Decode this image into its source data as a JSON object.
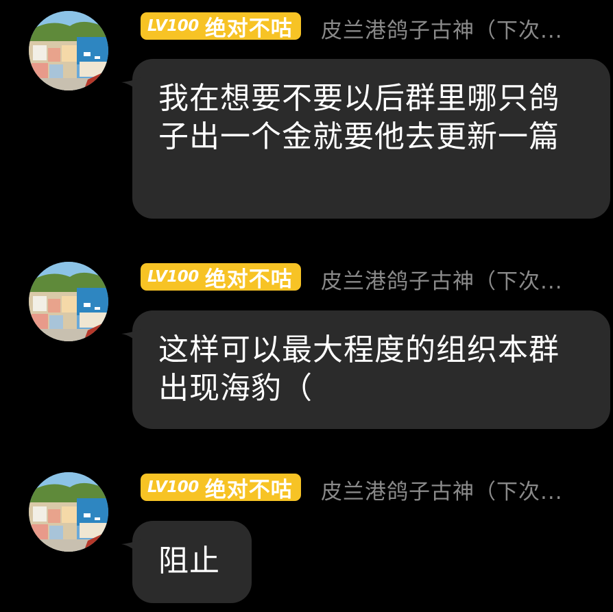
{
  "messages": [
    {
      "level": "LV100",
      "title": "绝对不咕",
      "sender": "皮兰港鸽子古神（下次...",
      "text": "我在想要不要以后群里哪只鸽子出一个金就要他去更新一篇",
      "avatar_icon": "coastal-town-avatar"
    },
    {
      "level": "LV100",
      "title": "绝对不咕",
      "sender": "皮兰港鸽子古神（下次...",
      "text": "这样可以最大程度的组织本群出现海豹（",
      "avatar_icon": "coastal-town-avatar"
    },
    {
      "level": "LV100",
      "title": "绝对不咕",
      "sender": "皮兰港鸽子古神（下次...",
      "text": "阻止",
      "avatar_icon": "coastal-town-avatar"
    }
  ],
  "colors": {
    "background": "#000000",
    "bubble": "#2b2b2b",
    "badge": "#f7c325",
    "sender_text": "#8a8a8a",
    "message_text": "#ffffff"
  }
}
